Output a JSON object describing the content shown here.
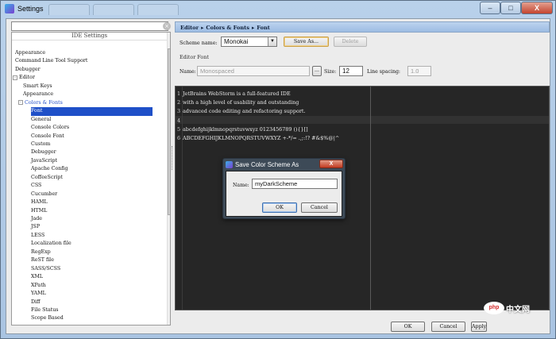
{
  "window": {
    "title": "Settings",
    "background_tabs": [
      "",
      "",
      ""
    ],
    "controls": {
      "minimize": "–",
      "maximize": "□",
      "close": "X"
    }
  },
  "sidebar": {
    "header": "IDE Settings",
    "items": [
      {
        "label": "Appearance"
      },
      {
        "label": "Command Line Tool Support"
      },
      {
        "label": "Debugger"
      },
      {
        "label": "Editor"
      },
      {
        "label": "Smart Keys"
      },
      {
        "label": "Appearance"
      },
      {
        "label": "Colors & Fonts"
      },
      {
        "label": "Font"
      },
      {
        "label": "General"
      },
      {
        "label": "Console Colors"
      },
      {
        "label": "Console Font"
      },
      {
        "label": "Custom"
      },
      {
        "label": "Debugger"
      },
      {
        "label": "JavaScript"
      },
      {
        "label": "Apache Config"
      },
      {
        "label": "CoffeeScript"
      },
      {
        "label": "CSS"
      },
      {
        "label": "Cucumber"
      },
      {
        "label": "HAML"
      },
      {
        "label": "HTML"
      },
      {
        "label": "Jade"
      },
      {
        "label": "JSP"
      },
      {
        "label": "LESS"
      },
      {
        "label": "Localization file"
      },
      {
        "label": "RegExp"
      },
      {
        "label": "ReST file"
      },
      {
        "label": "SASS/SCSS"
      },
      {
        "label": "XML"
      },
      {
        "label": "XPath"
      },
      {
        "label": "YAML"
      },
      {
        "label": "Diff"
      },
      {
        "label": "File Status"
      },
      {
        "label": "Scope Based"
      }
    ]
  },
  "breadcrumb": [
    "Editor",
    "Colors & Fonts",
    "Font"
  ],
  "breadcrumb_sep": "▸",
  "scheme": {
    "label": "Scheme name:",
    "value": "Monokai",
    "save_as": "Save As...",
    "delete": "Delete"
  },
  "editor_font": {
    "section_label": "Editor Font",
    "name_label": "Name:",
    "name_value": "Monospaced",
    "browse": "...",
    "size_label": "Size:",
    "size_value": "12",
    "line_spacing_label": "Line spacing:",
    "line_spacing_value": "1.0"
  },
  "preview": {
    "lines": [
      {
        "num": "1",
        "text": "JetBrains WebStorm is a full-featured IDE"
      },
      {
        "num": "2",
        "text": "with a high level of usability and outstanding"
      },
      {
        "num": "3",
        "text": "advanced code editing and refactoring support."
      },
      {
        "num": "4",
        "text": ""
      },
      {
        "num": "5",
        "text": "abcdefghijklmnopqrstuvwxyz 0123456789 (){}[]"
      },
      {
        "num": "6",
        "text": "ABCDEFGHIJKLMNOPQRSTUVWXYZ +-*/= .,;:!? #&$%@|^"
      }
    ]
  },
  "dialog": {
    "title": "Save Color Scheme As",
    "close": "X",
    "name_label": "Name:",
    "name_value": "myDarkScheme",
    "ok": "OK",
    "cancel": "Cancel"
  },
  "footer": {
    "ok": "OK",
    "cancel": "Cancel",
    "apply": "Apply"
  },
  "watermark": {
    "logo": "php",
    "text": "中文网"
  },
  "colors": {
    "selection": "#1f50c8",
    "editor_bg": "#262626",
    "accent_link": "#2b55c8"
  }
}
